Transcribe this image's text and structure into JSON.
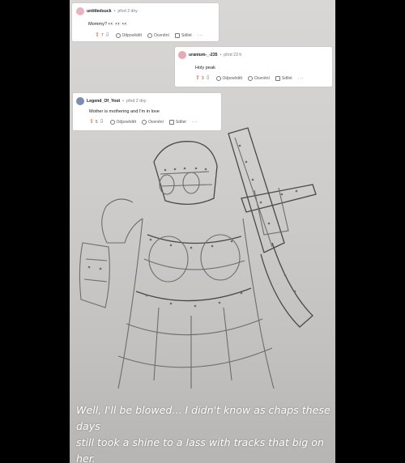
{
  "comments": [
    {
      "username": "untitledsuck",
      "separator": "•",
      "time": "před 2 dny",
      "text": "Mommy? 👀 👀 👀",
      "score": "7",
      "reply": "Odpovědět",
      "award": "Ocenění",
      "share": "Sdílet",
      "more": "···",
      "avatar_color": "#e8b4bf"
    },
    {
      "username": "uranium-_-235",
      "separator": "•",
      "time": "před 23 h",
      "text": "Holy peak",
      "score": "3",
      "reply": "Odpovědět",
      "award": "Ocenění",
      "share": "Sdílet",
      "more": "···",
      "avatar_color": "#e8a9b6"
    },
    {
      "username": "Legend_Of_Yoot",
      "separator": "•",
      "time": "před 2 dny",
      "text": "Mother is mothering and I'm in love",
      "score": "5",
      "reply": "Odpovědět",
      "award": "Ocenění",
      "share": "Sdílet",
      "more": "···",
      "avatar_color": "#7a8fb0"
    }
  ],
  "caption": {
    "line1": "Well, I'll be blowed... I didn't know as chaps these days",
    "line2": "still took a shine to a lass with tracks that big on her."
  },
  "colors": {
    "upvote": "#d93a00",
    "background": "#000000",
    "paper": "#d6d4d3"
  }
}
